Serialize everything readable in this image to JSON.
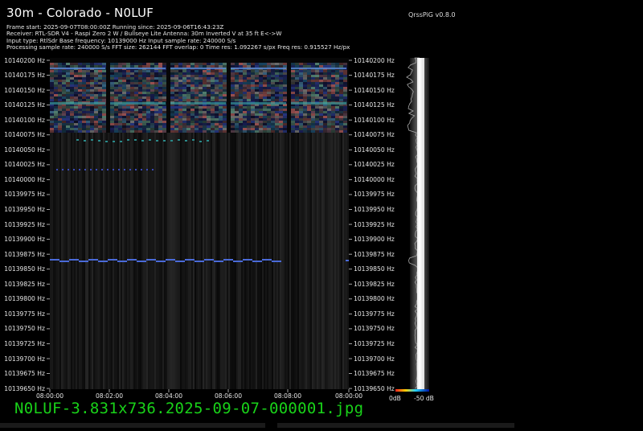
{
  "title": "30m - Colorado - N0LUF",
  "version": "QrssPiG v0.8.0",
  "info_lines": [
    "Frame start: 2025-09-07T08:00:00Z Running since: 2025-09-06T16:43:23Z",
    "Receiver: RTL-SDR V4 - Raspi Zero 2 W / Bullseye Lite Antenna: 30m Inverted V at 35 ft E<->W",
    "Input type: RtlSdr Base frequency: 10139000 Hz Input sample rate: 240000 S/s",
    "Processing sample rate: 240000 S/s FFT size: 262144 FFT overlap: 0 Time res: 1.092267 s/px Freq res: 0.915527 Hz/px"
  ],
  "freq_labels": [
    "10140200 Hz",
    "10140175 Hz",
    "10140150 Hz",
    "10140125 Hz",
    "10140100 Hz",
    "10140075 Hz",
    "10140050 Hz",
    "10140025 Hz",
    "10140000 Hz",
    "10139975 Hz",
    "10139950 Hz",
    "10139925 Hz",
    "10139900 Hz",
    "10139875 Hz",
    "10139850 Hz",
    "10139825 Hz",
    "10139800 Hz",
    "10139775 Hz",
    "10139750 Hz",
    "10139725 Hz",
    "10139700 Hz",
    "10139675 Hz",
    "10139650 Hz"
  ],
  "time_labels": [
    "08:00:00",
    "08:02:00",
    "08:04:00",
    "08:06:00",
    "08:08:00",
    "08:00:00"
  ],
  "db_labels": {
    "left": "0dB",
    "right": "-50 dB"
  },
  "filename": "N0LUF-3.831x736.2025-09-07-000001.jpg",
  "colors": {
    "background": "#000000",
    "filename": "#19d219",
    "signal": "#4a6ad8"
  }
}
